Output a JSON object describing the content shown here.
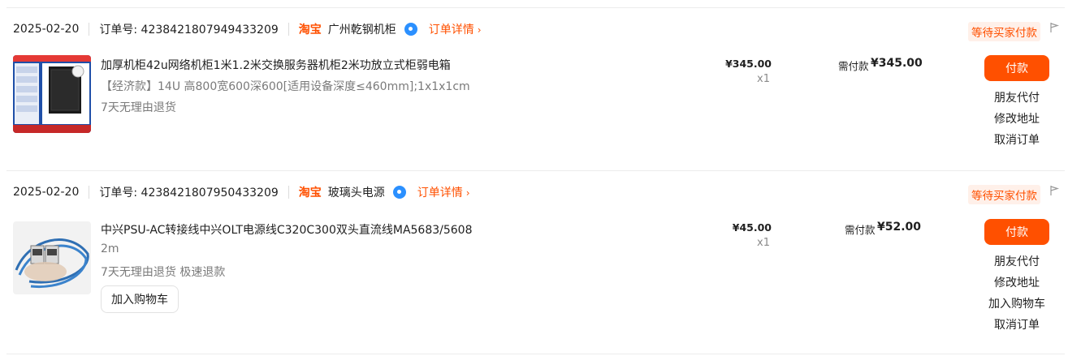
{
  "orders": [
    {
      "date": "2025-02-20",
      "order_no": "订单号: 4238421807949433209",
      "platform": "淘宝",
      "shop": "广州乾钢机柜",
      "detail_label": "订单详情",
      "status": "等待买家付款",
      "item": {
        "title": "加厚机柜42u网络机柜1米1.2米交换服务器机柜2米功放立式柜弱电箱",
        "sku": "【经济款】14U 高800宽600深600[适用设备深度≤460mm];1x1x1cm",
        "service": "7天无理由退货",
        "price": "¥345.00",
        "qty": "x1"
      },
      "pay_label": "需付款",
      "pay_amount": "¥345.00",
      "actions": {
        "pay": "付款",
        "friend_pay": "朋友代付",
        "modify_address": "修改地址",
        "cancel": "取消订单"
      }
    },
    {
      "date": "2025-02-20",
      "order_no": "订单号: 4238421807950433209",
      "platform": "淘宝",
      "shop": "玻璃头电源",
      "detail_label": "订单详情",
      "status": "等待买家付款",
      "item": {
        "title": "中兴PSU-AC转接线中兴OLT电源线C320C300双头直流线MA5683/5608",
        "sku": "2m",
        "service": "7天无理由退货 极速退款",
        "add_cart": "加入购物车",
        "price": "¥45.00",
        "qty": "x1"
      },
      "pay_label": "需付款",
      "pay_amount": "¥52.00",
      "actions": {
        "pay": "付款",
        "friend_pay": "朋友代付",
        "modify_address": "修改地址",
        "add_cart": "加入购物车",
        "cancel": "取消订单"
      }
    }
  ],
  "colors": {
    "accent": "#ff5000",
    "status_bg": "#fff0e9",
    "wangwang": "#2b90ff"
  }
}
